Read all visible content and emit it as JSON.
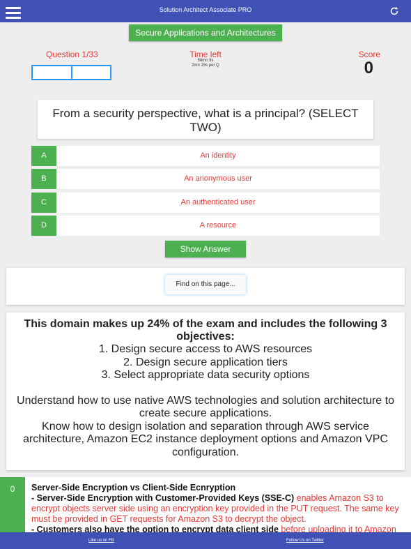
{
  "header": {
    "title": "Solution Architect Associate PRO",
    "menu_icon": "hamburger-menu-icon",
    "refresh_icon": "refresh-icon"
  },
  "category": {
    "label": "Secure Applications and Architectures"
  },
  "stats": {
    "question_label": "Question 1/33",
    "time_label": "Time left",
    "time_value": "58mn 9s",
    "time_per_q": "2mn 15s per Q",
    "score_label": "Score",
    "score_value": "0"
  },
  "question": {
    "text": "From a security perspective, what is a principal? (SELECT TWO)"
  },
  "answers": [
    {
      "letter": "A",
      "text": "An identity"
    },
    {
      "letter": "B",
      "text": "An anonymous user"
    },
    {
      "letter": "C",
      "text": "An authenticated user"
    },
    {
      "letter": "D",
      "text": "A resource"
    }
  ],
  "show_answer_label": "Show Answer",
  "find_label": "Find on this page...",
  "domain": {
    "heading": "This domain makes up 24% of the exam and includes the following 3 objectives:",
    "objectives": [
      "1. Design secure access to AWS resources",
      "2. Design secure application tiers",
      "3. Select appropriate data security options"
    ],
    "paragraphs": [
      "Understand how to use native AWS technologies and solution architecture to create secure applications.",
      "Know how to design isolation and separation through AWS service architecture, Amazon EC2 instance deployment options and Amazon VPC configuration."
    ]
  },
  "notes": {
    "number": "0",
    "title": "Server-Side Encryption vs Client-Side Ecnryption",
    "item1_bold": "- Server-Side Encryption with Customer-Provided Keys (SSE-C)",
    "item1_red": " enables Amazon S3 to encrypt objects server side using an encryption key provided in the PUT request. The same key must be provided in GET requests for Amazon S3 to decrypt the object.",
    "item2_bold": "- Customers also have the option to encrypt data client side",
    "item2_red": " before uploading it to Amazon"
  },
  "footer": {
    "facebook_label": "Like us on FB",
    "twitter_label": "Follow Us on Twitter"
  },
  "colors": {
    "bar": "#3f51b5",
    "green": "#4caf50",
    "red": "#e53935",
    "blue_outline": "#2196f3"
  }
}
